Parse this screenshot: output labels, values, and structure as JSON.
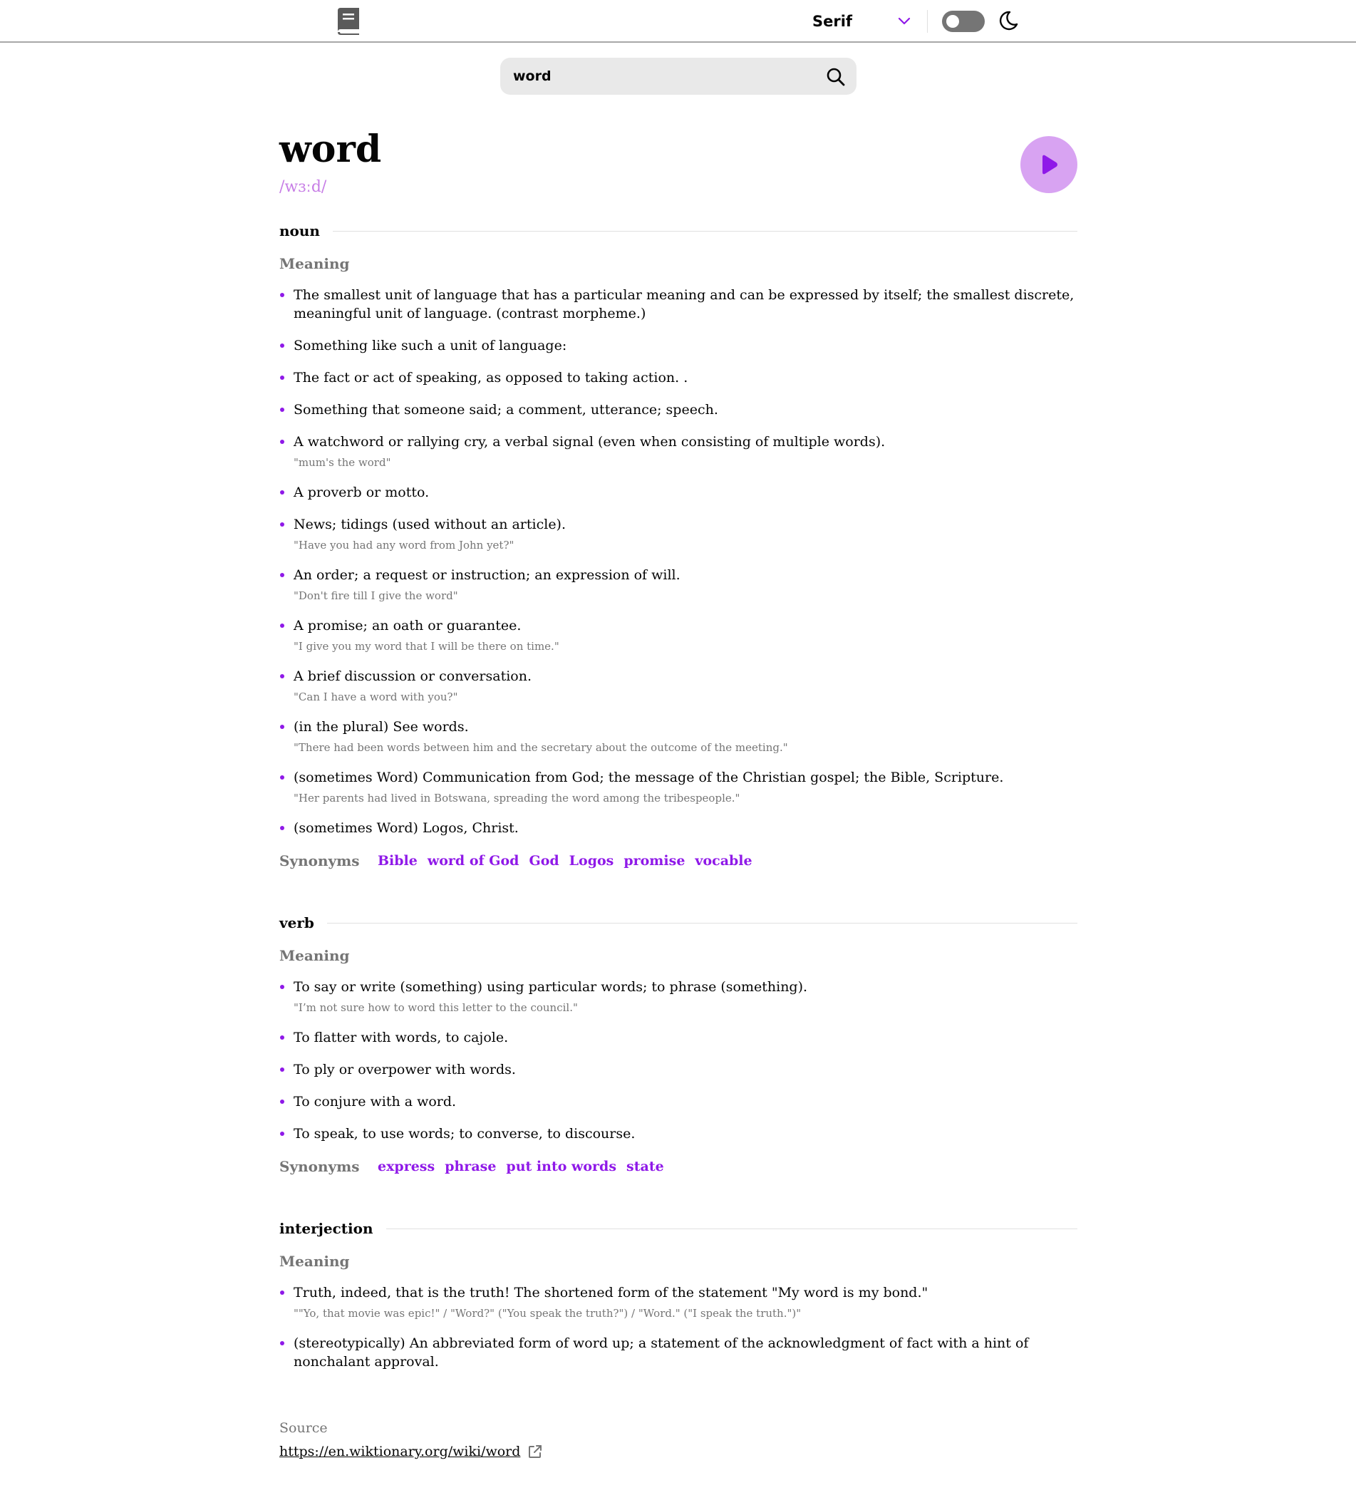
{
  "header": {
    "font_selector": {
      "selected": "Serif"
    },
    "theme": {
      "mode": "light"
    }
  },
  "search": {
    "value": "word"
  },
  "entry": {
    "word": "word",
    "phonetic": "/wɜːd/",
    "meanings": [
      {
        "part_of_speech": "noun",
        "meaning_label": "Meaning",
        "definitions": [
          {
            "text": "The smallest unit of language that has a particular meaning and can be expressed by itself; the smallest discrete, meaningful unit of language. (contrast morpheme.)",
            "example": ""
          },
          {
            "text": "Something like such a unit of language:",
            "example": ""
          },
          {
            "text": "The fact or act of speaking, as opposed to taking action. .",
            "example": ""
          },
          {
            "text": "Something that someone said; a comment, utterance; speech.",
            "example": ""
          },
          {
            "text": "A watchword or rallying cry, a verbal signal (even when consisting of multiple words).",
            "example": "\"mum's the word\""
          },
          {
            "text": "A proverb or motto.",
            "example": ""
          },
          {
            "text": "News; tidings (used without an article).",
            "example": "\"Have you had any word from John yet?\""
          },
          {
            "text": "An order; a request or instruction; an expression of will.",
            "example": "\"Don't fire till I give the word\""
          },
          {
            "text": "A promise; an oath or guarantee.",
            "example": "\"I give you my word that I will be there on time.\""
          },
          {
            "text": "A brief discussion or conversation.",
            "example": "\"Can I have a word with you?\""
          },
          {
            "text": "(in the plural) See words.",
            "example": "\"There had been words between him and the secretary about the outcome of the meeting.\""
          },
          {
            "text": "(sometimes Word) Communication from God; the message of the Christian gospel; the Bible, Scripture.",
            "example": "\"Her parents had lived in Botswana, spreading the word among the tribespeople.\""
          },
          {
            "text": "(sometimes Word) Logos, Christ.",
            "example": ""
          }
        ],
        "synonyms_label": "Synonyms",
        "synonyms": [
          "Bible",
          "word of God",
          "God",
          "Logos",
          "promise",
          "vocable"
        ]
      },
      {
        "part_of_speech": "verb",
        "meaning_label": "Meaning",
        "definitions": [
          {
            "text": "To say or write (something) using particular words; to phrase (something).",
            "example": "\"I’m not sure how to word this letter to the council.\""
          },
          {
            "text": "To flatter with words, to cajole.",
            "example": ""
          },
          {
            "text": "To ply or overpower with words.",
            "example": ""
          },
          {
            "text": "To conjure with a word.",
            "example": ""
          },
          {
            "text": "To speak, to use words; to converse, to discourse.",
            "example": ""
          }
        ],
        "synonyms_label": "Synonyms",
        "synonyms": [
          "express",
          "phrase",
          "put into words",
          "state"
        ]
      },
      {
        "part_of_speech": "interjection",
        "meaning_label": "Meaning",
        "definitions": [
          {
            "text": "Truth, indeed, that is the truth! The shortened form of the statement \"My word is my bond.\"",
            "example": "\"\"Yo, that movie was epic!\" / \"Word?\" (\"You speak the truth?\") / \"Word.\" (\"I speak the truth.\")\""
          },
          {
            "text": "(stereotypically) An abbreviated form of word up; a statement of the acknowledgment of fact with a hint of nonchalant approval.",
            "example": ""
          }
        ],
        "synonyms_label": "",
        "synonyms": []
      }
    ],
    "source": {
      "label": "Source",
      "url": "https://en.wiktionary.org/wiki/word"
    }
  },
  "icons": {
    "logo": "book-icon",
    "dropdown": "chevron-down-icon",
    "theme_toggle": "toggle-switch",
    "theme": "moon-icon",
    "search": "search-icon",
    "play": "play-icon",
    "external": "external-link-icon"
  },
  "colors": {
    "accent": "#8f19e8",
    "accent_light": "#d8a3f2",
    "phonetic": "#c77ee6",
    "muted_text": "#757575",
    "search_bg": "#e9e9e9",
    "divider": "#e0e0e0",
    "toggle_off": "#757575"
  }
}
